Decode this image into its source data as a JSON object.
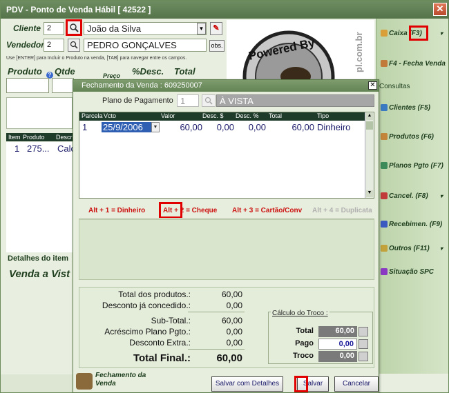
{
  "window": {
    "title": "PDV - Ponto de Venda Hábil [ 42522 ]"
  },
  "form": {
    "cliente_label": "Cliente",
    "cliente_code": "2",
    "cliente_name": "João da Silva",
    "vendedor_label": "Vendedor",
    "vendedor_code": "2",
    "vendedor_name": "PEDRO GONÇALVES",
    "obs_button": "obs.",
    "hint": "Use [ENTER] para Incluir o Produto na venda, [TAB] para navegar entre os campos.",
    "col_produto": "Produto",
    "col_qtde": "Qtde",
    "col_preco": "Preço",
    "col_desc": "%Desc.",
    "col_total": "Total",
    "list_head_item": "Item",
    "list_head_produto": "Produto",
    "list_head_descr": "Descr",
    "list_row_item": "1",
    "list_row_produto": "275...",
    "list_row_descr": "Calc",
    "details_label": "Detalhes do item",
    "sale_label": "Venda a Vist"
  },
  "logo": {
    "text": "Powered By",
    "side_text": "pl.com.br"
  },
  "right_panel": {
    "items": [
      {
        "label": "Caixa (F3)",
        "color": "#d9a03a"
      },
      {
        "label": "F4 - Fecha Venda",
        "color": "#c27a3a"
      },
      {
        "label": "Consultas",
        "color": ""
      },
      {
        "label": "Clientes (F5)",
        "color": "#3a7ac2"
      },
      {
        "label": "Produtos (F6)",
        "color": "#c2853a"
      },
      {
        "label": "Planos Pgto (F7)",
        "color": "#3a8a5a"
      },
      {
        "label": "Cancel. (F8)",
        "color": "#c23a3a"
      },
      {
        "label": "Recebimen. (F9)",
        "color": "#3a5ac2"
      },
      {
        "label": "Outros (F11)",
        "color": "#c2a23a"
      },
      {
        "label": "Situação SPC",
        "color": "#8a3ac2"
      }
    ]
  },
  "dialog": {
    "title": "Fechamento da Venda : 609250007",
    "plano_label": "Plano de Pagamento",
    "plano_code": "1",
    "plano_name": "À VISTA",
    "grid_headers": [
      "Parcela",
      "Vcto",
      "Valor",
      "Desc. $",
      "Desc. %",
      "Total",
      "Tipo"
    ],
    "grid_row": {
      "parcela": "1",
      "vcto": "25/9/2006",
      "valor": "60,00",
      "desc_val": "0,00",
      "desc_pct": "0,00",
      "total": "60,00",
      "tipo": "Dinheiro"
    },
    "tabs": [
      "Alt + 1 = Dinheiro",
      "Alt + 2 = Cheque",
      "Alt + 3 = Cartão/Conv",
      "Alt + 4 = Duplicata"
    ],
    "totals": [
      {
        "label": "Total dos produtos.:",
        "value": "60,00"
      },
      {
        "label": "Desconto já concedido.:",
        "value": "0,00"
      },
      {
        "label": "Sub-Total.:",
        "value": "60,00"
      },
      {
        "label": "Acréscimo Plano Pgto.:",
        "value": "0,00"
      },
      {
        "label": "Desconto Extra.:",
        "value": "0,00"
      },
      {
        "label": "Total Final.:",
        "value": "60,00"
      }
    ],
    "troco": {
      "title": "Cálculo do Troco :",
      "total_label": "Total",
      "total_value": "60,00",
      "pago_label": "Pago",
      "pago_value": "0,00",
      "troco_label": "Troco",
      "troco_value": "0,00"
    },
    "footer_caption": "Fechamento da Venda",
    "buttons": {
      "save_details": "Salvar com Detalhes",
      "save": "Salvar",
      "cancel": "Cancelar"
    }
  }
}
